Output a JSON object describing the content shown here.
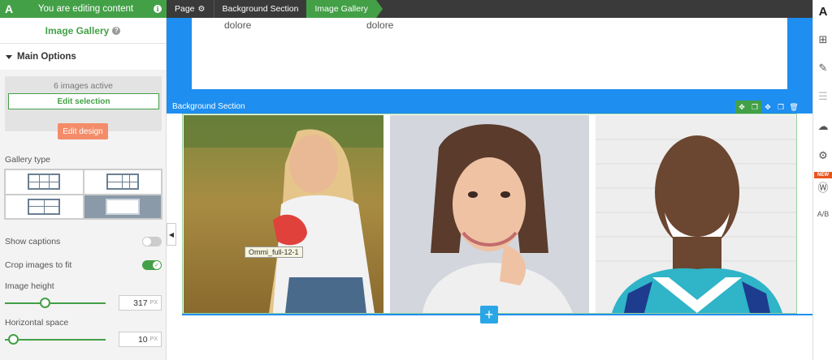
{
  "topbar": {
    "logo": "A",
    "editing_text": "You are editing content",
    "info_glyph": "i",
    "crumbs": [
      "Page",
      "Background Section",
      "Image Gallery"
    ]
  },
  "panel": {
    "title": "Image Gallery",
    "help_glyph": "?",
    "section": "Main Options",
    "active_count": "6 images active",
    "edit_selection": "Edit selection",
    "edit_design": "Edit design",
    "gallery_type_label": "Gallery type",
    "show_captions_label": "Show captions",
    "show_captions": false,
    "crop_label": "Crop images to fit",
    "crop": true,
    "image_height_label": "Image height",
    "image_height": "317",
    "horizontal_space_label": "Horizontal space",
    "horizontal_space": "10",
    "unit": "PX"
  },
  "canvas": {
    "dolore_1": "dolore",
    "dolore_2": "dolore",
    "section_label": "Background Section",
    "tooltip": "Ommi_full-12-1",
    "add_glyph": "+"
  },
  "rail": {
    "logo": "A",
    "new_badge": "NEW",
    "ab": "A/B"
  },
  "colors": {
    "accent_green": "#43a047",
    "section_blue": "#1e8ef0",
    "edit_design": "#f48c6a"
  }
}
